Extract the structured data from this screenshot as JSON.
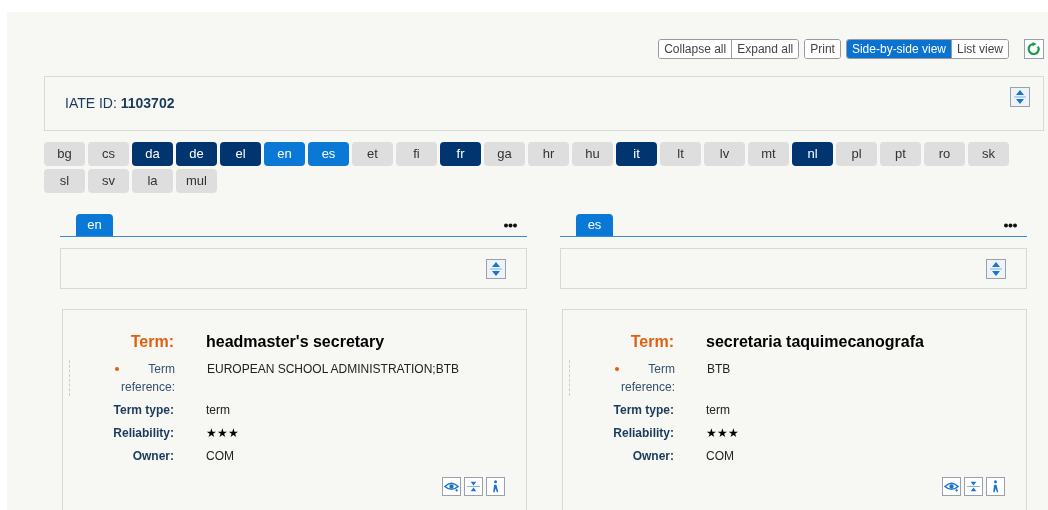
{
  "toolbar": {
    "groups": [
      {
        "buttons": [
          {
            "label": "Collapse all",
            "selected": false
          },
          {
            "label": "Expand all",
            "selected": false
          }
        ]
      },
      {
        "buttons": [
          {
            "label": "Print",
            "selected": false
          }
        ]
      },
      {
        "buttons": [
          {
            "label": "Side-by-side view",
            "selected": true
          },
          {
            "label": "List view",
            "selected": false
          }
        ]
      }
    ]
  },
  "entry": {
    "id_label": "IATE ID:",
    "id_value": "1103702"
  },
  "languages": [
    {
      "code": "bg",
      "selected": false,
      "has_entry": false
    },
    {
      "code": "cs",
      "selected": false,
      "has_entry": false
    },
    {
      "code": "da",
      "selected": false,
      "has_entry": true
    },
    {
      "code": "de",
      "selected": false,
      "has_entry": true
    },
    {
      "code": "el",
      "selected": false,
      "has_entry": true
    },
    {
      "code": "en",
      "selected": true
    },
    {
      "code": "es",
      "selected": true
    },
    {
      "code": "et",
      "selected": false,
      "has_entry": false
    },
    {
      "code": "fi",
      "selected": false,
      "has_entry": false
    },
    {
      "code": "fr",
      "selected": false,
      "has_entry": true
    },
    {
      "code": "ga",
      "selected": false,
      "has_entry": false
    },
    {
      "code": "hr",
      "selected": false,
      "has_entry": false
    },
    {
      "code": "hu",
      "selected": false,
      "has_entry": false
    },
    {
      "code": "it",
      "selected": false,
      "has_entry": true
    },
    {
      "code": "lt",
      "selected": false,
      "has_entry": false
    },
    {
      "code": "lv",
      "selected": false,
      "has_entry": false
    },
    {
      "code": "mt",
      "selected": false,
      "has_entry": false
    },
    {
      "code": "nl",
      "selected": false,
      "has_entry": true
    },
    {
      "code": "pl",
      "selected": false,
      "has_entry": false
    },
    {
      "code": "pt",
      "selected": false,
      "has_entry": false
    },
    {
      "code": "ro",
      "selected": false,
      "has_entry": false
    },
    {
      "code": "sk",
      "selected": false,
      "has_entry": false
    },
    {
      "code": "sl",
      "selected": false,
      "has_entry": false
    },
    {
      "code": "sv",
      "selected": false,
      "has_entry": false
    },
    {
      "code": "la",
      "selected": false,
      "has_entry": false
    },
    {
      "code": "mul",
      "selected": false,
      "has_entry": false
    }
  ],
  "panels": [
    {
      "tab": "en",
      "term_label": "Term:",
      "term": "headmaster's secretary",
      "fields": [
        {
          "kind": "reference",
          "label": "Term reference:",
          "value": "EUROPEAN SCHOOL ADMINISTRATION;BTB"
        },
        {
          "kind": "text",
          "label": "Term type:",
          "value": "term"
        },
        {
          "kind": "stars",
          "label": "Reliability:",
          "stars": 3
        },
        {
          "kind": "text",
          "label": "Owner:",
          "value": "COM"
        }
      ]
    },
    {
      "tab": "es",
      "term_label": "Term:",
      "term": "secretaria taquimecanografa",
      "fields": [
        {
          "kind": "reference",
          "label": "Term reference:",
          "value": "BTB"
        },
        {
          "kind": "text",
          "label": "Term type:",
          "value": "term"
        },
        {
          "kind": "stars",
          "label": "Reliability:",
          "stars": 3
        },
        {
          "kind": "text",
          "label": "Owner:",
          "value": "COM"
        }
      ]
    }
  ]
}
